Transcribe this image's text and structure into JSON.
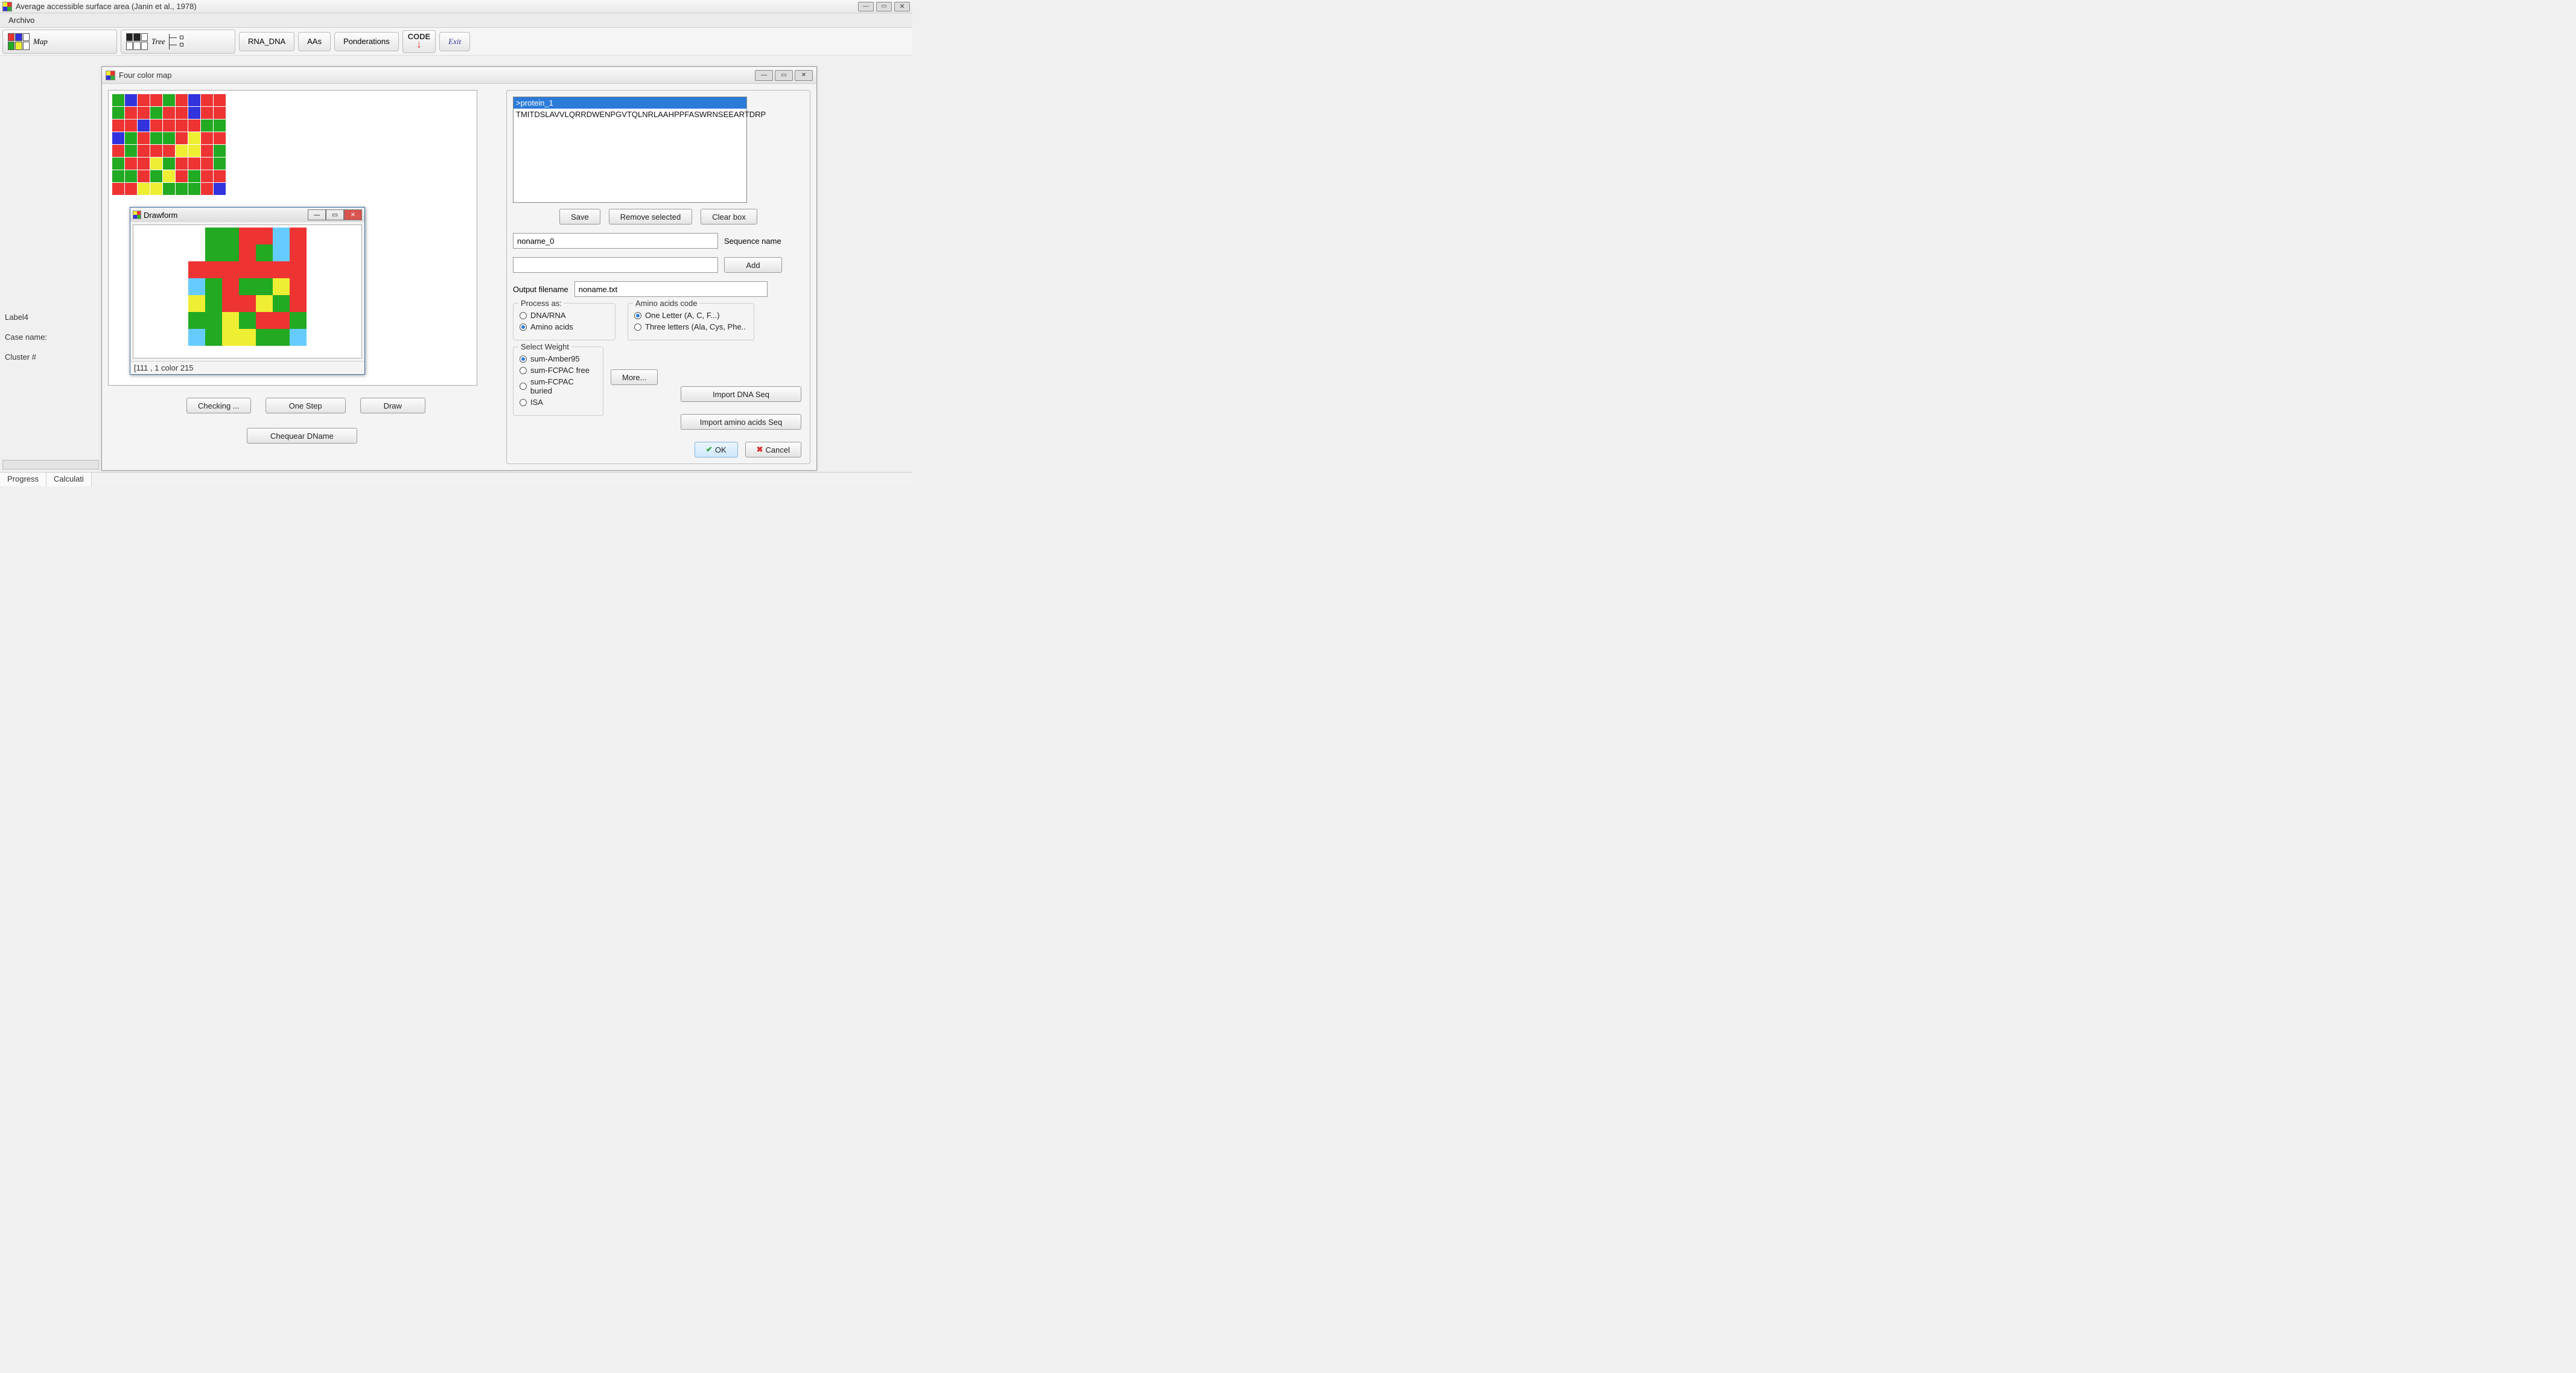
{
  "titlebar": {
    "title": "Average accessible surface area (Janin et al., 1978)",
    "faded": ""
  },
  "menu": {
    "archivo": "Archivo"
  },
  "toolbar": {
    "map": "Map",
    "tree": "Tree",
    "rna_dna": "RNA_DNA",
    "aas": "AAs",
    "ponderations": "Ponderations",
    "code": "CODE",
    "exit": "Exit"
  },
  "sidelabels": {
    "l4": "Label4",
    "case": "Case name:",
    "cluster": "Cluster #"
  },
  "fcm": {
    "title": "Four color map",
    "checking": "Checking ...",
    "onestep": "One Step",
    "draw": "Draw",
    "chequear": "Chequear DName"
  },
  "drawform": {
    "title": "Drawform",
    "status": "[111 , 1 color 215"
  },
  "rp": {
    "seq_header": ">protein_1",
    "seq_body": "TMITDSLAVVLQRRDWENPGVTQLNRLAAHPPFASWRNSEEARTDRP",
    "save": "Save",
    "remove": "Remove selected",
    "clear": "Clear box",
    "seqname_val": "noname_0",
    "seqname_lbl": "Sequence name",
    "add": "Add",
    "outputfn_lbl": "Output filename",
    "outputfn_val": "noname.txt",
    "process_legend": "Process as:",
    "process_dna": "DNA/RNA",
    "process_aa": "Amino acids",
    "aacode_legend": "Amino acids code",
    "aacode_one": "One Letter (A, C, F...)",
    "aacode_three": "Three letters (Ala, Cys, Phe..",
    "weight_legend": "Select Weight",
    "w1": "sum-Amber95",
    "w2": "sum-FCPAC free",
    "w3": "sum-FCPAC buried",
    "w4": "ISA",
    "more": "More...",
    "import_dna": "Import DNA Seq",
    "import_aa": "Import amino acids Seq",
    "ok": "OK",
    "cancel": "Cancel"
  },
  "bottom": {
    "progress": "Progress",
    "calc": "Calculati"
  },
  "chart_data": {
    "type": "heatmap",
    "note": "Two categorical color-grid maps; colors encode region/cluster class (red/green/blue/yellow/cyan). No numeric axes.",
    "palette": {
      "r": "#e33",
      "g": "#2a2",
      "b": "#33d",
      "y": "#ee3",
      "cy": "#6cf",
      "w": "#fff"
    },
    "main_grid_rows": [
      [
        "g",
        "b",
        "r",
        "r",
        "g",
        "r",
        "b",
        "r",
        "r"
      ],
      [
        "g",
        "r",
        "r",
        "g",
        "r",
        "r",
        "b",
        "r",
        "r"
      ],
      [
        "r",
        "r",
        "b",
        "r",
        "r",
        "r",
        "r",
        "g",
        "g"
      ],
      [
        "b",
        "g",
        "r",
        "g",
        "g",
        "r",
        "y",
        "r",
        "r"
      ],
      [
        "r",
        "g",
        "r",
        "r",
        "r",
        "y",
        "y",
        "r",
        "g"
      ],
      [
        "g",
        "r",
        "r",
        "y",
        "g",
        "r",
        "r",
        "r",
        "g"
      ],
      [
        "g",
        "g",
        "r",
        "g",
        "y",
        "r",
        "g",
        "r",
        "r"
      ],
      [
        "r",
        "r",
        "y",
        "y",
        "g",
        "g",
        "g",
        "r",
        "b"
      ]
    ],
    "drawform_grid_rows": [
      [
        "w",
        "g",
        "g",
        "r",
        "r",
        "cy",
        "r"
      ],
      [
        "w",
        "g",
        "g",
        "r",
        "g",
        "cy",
        "r"
      ],
      [
        "r",
        "r",
        "r",
        "r",
        "r",
        "r",
        "r"
      ],
      [
        "cy",
        "g",
        "r",
        "g",
        "g",
        "y",
        "r"
      ],
      [
        "y",
        "g",
        "r",
        "r",
        "y",
        "g",
        "r"
      ],
      [
        "g",
        "g",
        "y",
        "g",
        "r",
        "r",
        "g"
      ],
      [
        "cy",
        "g",
        "y",
        "y",
        "g",
        "g",
        "cy"
      ]
    ]
  }
}
